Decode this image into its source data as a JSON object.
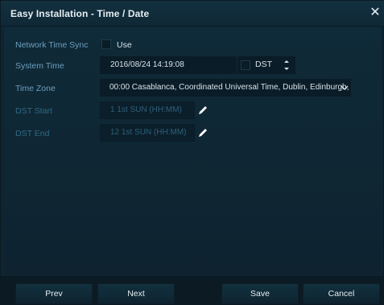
{
  "window": {
    "title": "Easy Installation - Time / Date"
  },
  "labels": {
    "network_time_sync": "Network Time Sync",
    "system_time": "System Time",
    "time_zone": "Time Zone",
    "dst_start": "DST Start",
    "dst_end": "DST End"
  },
  "network_time_sync": {
    "checkbox_label": "Use"
  },
  "system_time": {
    "value": "2016/08/24 14:19:08"
  },
  "dst": {
    "checkbox_label": "DST"
  },
  "time_zone": {
    "selected": "00:00 Casablanca, Coordinated Universal Time, Dublin, Edinburgh,"
  },
  "dst_start": {
    "value": "1 1st SUN (HH:MM)"
  },
  "dst_end": {
    "value": "12 1st SUN (HH:MM)"
  },
  "footer": {
    "prev": "Prev",
    "next": "Next",
    "save": "Save",
    "cancel": "Cancel"
  },
  "icons": {
    "close": "close-icon",
    "edit": "pencil-icon",
    "spin": "spin-up-down-icon",
    "dropdown": "chevron-down-icon"
  },
  "colors": {
    "label_blue": "#6c9fbe",
    "disabled_blue": "#2f6986",
    "text": "#d7e2ea"
  }
}
